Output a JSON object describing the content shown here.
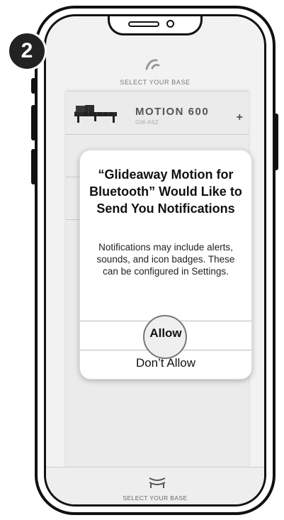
{
  "step": {
    "number": "2"
  },
  "header": {
    "title": "SELECT YOUR BASE",
    "logo_icon": "glideaway-logo-icon"
  },
  "bases": [
    {
      "title": "MOTION 600",
      "subtitle": "GM-A6Z",
      "action": "+"
    },
    {
      "title": "",
      "subtitle": "",
      "action": "+"
    },
    {
      "title": "",
      "subtitle": "",
      "action": "+"
    }
  ],
  "dialog": {
    "title": "“Glideaway Motion for Bluetooth” Would Like to Send You Notifications",
    "message": "Notifications may include alerts, sounds, and icon badges. These can be configured in Settings.",
    "allow_label": "Allow",
    "dont_allow_label": "Don’t Allow"
  },
  "bottom_nav": {
    "label": "SELECT YOUR BASE",
    "icon": "adjustable-base-icon"
  }
}
